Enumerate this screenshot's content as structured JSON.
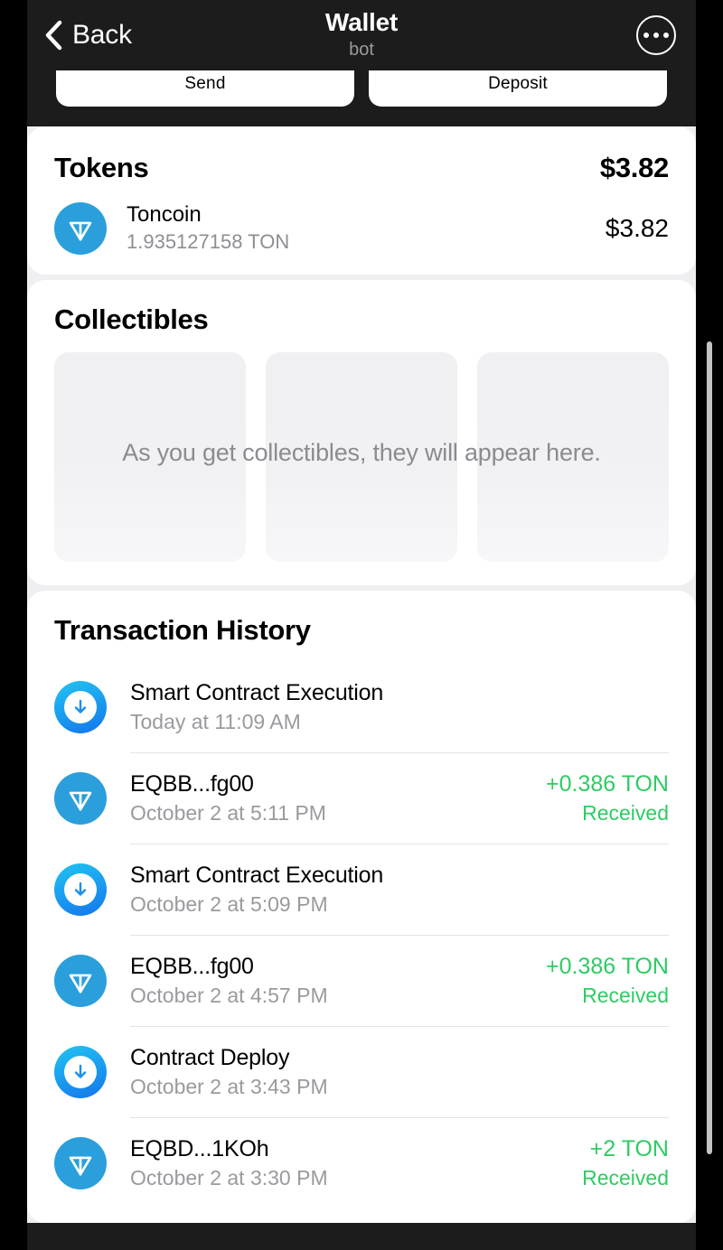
{
  "header": {
    "back_label": "Back",
    "title": "Wallet",
    "subtitle": "bot",
    "back_icon": "chevron-left-icon",
    "menu_icon": "ellipsis-circle-icon"
  },
  "actions": {
    "send_label": "Send",
    "deposit_label": "Deposit"
  },
  "tokens": {
    "title": "Tokens",
    "total": "$3.82",
    "items": [
      {
        "icon": "ton-logo-icon",
        "name": "Toncoin",
        "amount": "1.935127158 TON",
        "fiat": "$3.82"
      }
    ]
  },
  "collectibles": {
    "title": "Collectibles",
    "empty_text": "As you get collectibles, they will appear here."
  },
  "history": {
    "title": "Transaction History",
    "transactions": [
      {
        "icon": "download-arrow-icon",
        "title": "Smart Contract Execution",
        "date": "Today at 11:09 AM",
        "amount": "",
        "status": ""
      },
      {
        "icon": "ton-logo-icon",
        "title": "EQBB...fg00",
        "date": "October 2 at 5:11 PM",
        "amount": "+0.386 TON",
        "status": "Received"
      },
      {
        "icon": "download-arrow-icon",
        "title": "Smart Contract Execution",
        "date": "October 2 at 5:09 PM",
        "amount": "",
        "status": ""
      },
      {
        "icon": "ton-logo-icon",
        "title": "EQBB...fg00",
        "date": "October 2 at 4:57 PM",
        "amount": "+0.386 TON",
        "status": "Received"
      },
      {
        "icon": "download-arrow-icon",
        "title": "Contract Deploy",
        "date": "October 2 at 3:43 PM",
        "amount": "",
        "status": ""
      },
      {
        "icon": "ton-logo-icon",
        "title": "EQBD...1KOh",
        "date": "October 2 at 3:30 PM",
        "amount": "+2 TON",
        "status": "Received"
      }
    ]
  },
  "colors": {
    "header_bg": "#1c1c1c",
    "ton_blue": "#2a9fdc",
    "received_green": "#2ecc63",
    "muted_text": "#8e8e93",
    "card_bg": "#ffffff"
  }
}
